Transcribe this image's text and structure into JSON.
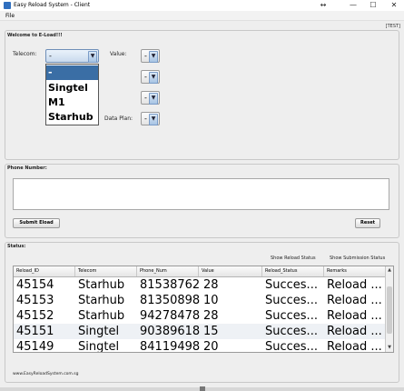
{
  "window": {
    "title": "Easy Reload System - Client",
    "extra_glyph": "↔",
    "min_glyph": "—",
    "max_glyph": "☐",
    "close_glyph": "✕"
  },
  "menu": {
    "file": "File"
  },
  "tag": "[TEST]",
  "eload": {
    "section_title": "Welcome to E-Load!!!",
    "telecom_label": "Telecom:",
    "telecom_selected": "-",
    "telecom_options": [
      "-",
      "Singtel",
      "M1",
      "Starhub"
    ],
    "value_label": "Value:",
    "value_combos": [
      "-",
      "-",
      "-"
    ],
    "data_plan_label": "Data Plan:",
    "data_plan_value": "-"
  },
  "phone": {
    "section_title": "Phone Number:",
    "value": "",
    "submit_label": "Submit Eload",
    "reset_label": "Reset"
  },
  "status": {
    "section_title": "Status:",
    "show_reload_status": "Show Reload Status",
    "show_submission_status": "Show Submission Status",
    "columns": [
      "Reload_ID",
      "Telecom",
      "Phone_Num",
      "Value",
      "Reload_Status",
      "Remarks"
    ],
    "rows": [
      [
        "45154",
        "Starhub",
        "81538762",
        "28",
        "Succes...",
        "Reload ..."
      ],
      [
        "45153",
        "Starhub",
        "81350898",
        "10",
        "Succes...",
        "Reload ..."
      ],
      [
        "45152",
        "Starhub",
        "94278478",
        "28",
        "Succes...",
        "Reload ..."
      ],
      [
        "45151",
        "Singtel",
        "90389618",
        "15",
        "Succes...",
        "Reload ..."
      ],
      [
        "45149",
        "Singtel",
        "84119498",
        "20",
        "Succes...",
        "Reload ..."
      ]
    ]
  },
  "footer": {
    "link": "www.EasyReloadSystem.com.sg"
  }
}
